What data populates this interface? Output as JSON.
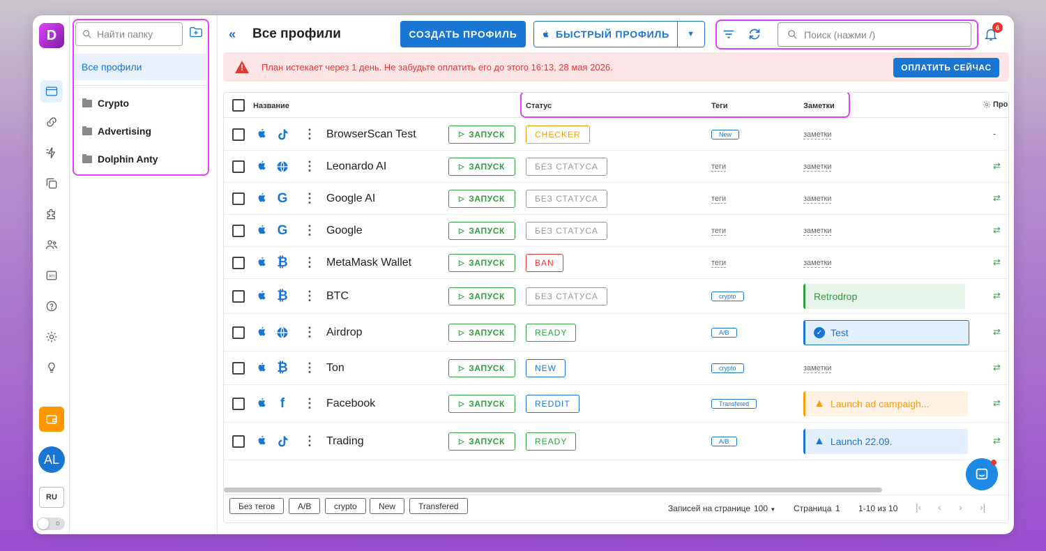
{
  "app": {
    "logo_letter": "D",
    "accent": "#1976d2",
    "highlight": "#e040fb"
  },
  "rail": {
    "icons": [
      "browser-profiles-icon",
      "link-icon",
      "automation-icon",
      "copy-icon",
      "extensions-icon",
      "users-icon",
      "api-icon",
      "help-icon",
      "settings-icon",
      "idea-icon"
    ],
    "avatar": "AL",
    "language": "RU"
  },
  "folders": {
    "search_placeholder": "Найти папку",
    "all_label": "Все профили",
    "items": [
      "Crypto",
      "Advertising",
      "Dolphin Anty"
    ]
  },
  "header": {
    "title": "Все профили",
    "create_label": "СОЗДАТЬ ПРОФИЛЬ",
    "quick_label": "БЫСТРЫЙ ПРОФИЛЬ",
    "search_placeholder": "Поиск (нажми /)",
    "notification_count": "6"
  },
  "alert": {
    "text": "План истекает через 1 день. Не забудьте оплатить его до этого 16:13, 28 мая 2026.",
    "button": "ОПЛАТИТЬ СЕЙЧАС"
  },
  "table": {
    "columns": {
      "name": "Название",
      "status": "Статус",
      "tags": "Теги",
      "notes": "Заметки",
      "proxy": "Прок"
    },
    "run_label": "ЗАПУСК",
    "rows": [
      {
        "name": "BrowserScan Test",
        "site": "tiktok",
        "status": "CHECKER",
        "status_color": "#f59e0b",
        "tag": "New",
        "tag_is_placeholder": false,
        "note": "заметки",
        "note_style": "text",
        "proxy": "-"
      },
      {
        "name": "Leonardo AI",
        "site": "globe",
        "status": "БЕЗ СТАТУСА",
        "status_color": "#999999",
        "tag": "теги",
        "tag_is_placeholder": true,
        "note": "заметки",
        "note_style": "text",
        "proxy": "⇄"
      },
      {
        "name": "Google AI",
        "site": "google",
        "status": "БЕЗ СТАТУСА",
        "status_color": "#999999",
        "tag": "теги",
        "tag_is_placeholder": true,
        "note": "заметки",
        "note_style": "text",
        "proxy": "⇄"
      },
      {
        "name": "Google",
        "site": "google",
        "status": "БЕЗ СТАТУСА",
        "status_color": "#999999",
        "tag": "теги",
        "tag_is_placeholder": true,
        "note": "заметки",
        "note_style": "text",
        "proxy": "⇄"
      },
      {
        "name": "MetaMask Wallet",
        "site": "bitcoin",
        "status": "BAN",
        "status_color": "#e53935",
        "tag": "теги",
        "tag_is_placeholder": true,
        "note": "заметки",
        "note_style": "text",
        "proxy": "⇄"
      },
      {
        "name": "BTC",
        "site": "bitcoin",
        "status": "БЕЗ СТАТУСА",
        "status_color": "#999999",
        "tag": "crypto",
        "tag_is_placeholder": false,
        "note": "Retrodrop",
        "note_style": "green",
        "proxy": "⇄"
      },
      {
        "name": "Airdrop",
        "site": "globe",
        "status": "READY",
        "status_color": "#2e9e3e",
        "tag": "A/B",
        "tag_is_placeholder": false,
        "note": "Test",
        "note_style": "blue-check",
        "proxy": "⇄"
      },
      {
        "name": "Ton",
        "site": "bitcoin",
        "status": "NEW",
        "status_color": "#1976d2",
        "tag": "crypto",
        "tag_is_placeholder": false,
        "note": "заметки",
        "note_style": "text",
        "proxy": "⇄"
      },
      {
        "name": "Facebook",
        "site": "facebook",
        "status": "REDDIT",
        "status_color": "#1976d2",
        "tag": "Transfered",
        "tag_is_placeholder": false,
        "note": "Launch ad campaigh...",
        "note_style": "orange-warning",
        "proxy": "⇄"
      },
      {
        "name": "Trading",
        "site": "tiktok",
        "status": "READY",
        "status_color": "#2e9e3e",
        "tag": "A/B",
        "tag_is_placeholder": false,
        "note": "Launch 22.09.",
        "note_style": "blue-warning",
        "proxy": "⇄"
      }
    ]
  },
  "footer": {
    "tag_filters": [
      "Без тегов",
      "A/B",
      "crypto",
      "New",
      "Transfered"
    ],
    "per_page_label": "Записей на странице",
    "per_page_value": "100",
    "page_label": "Страница",
    "page_value": "1",
    "range": "1-10 из 10"
  }
}
